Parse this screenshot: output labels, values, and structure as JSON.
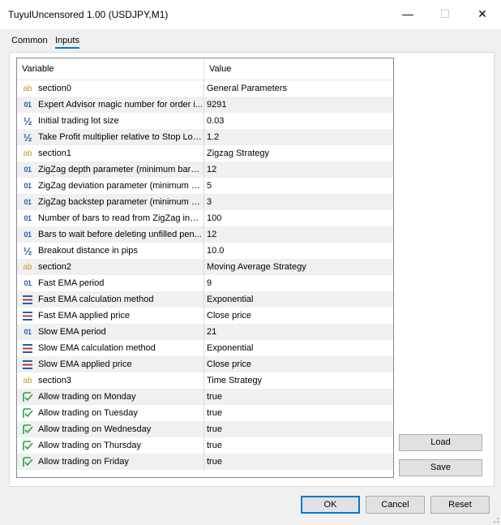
{
  "window": {
    "title": "TuyulUncensored 1.00 (USDJPY,M1)",
    "minimize_glyph": "—",
    "maximize_glyph": "☐",
    "close_glyph": "✕"
  },
  "tabs": [
    {
      "label": "Common"
    },
    {
      "label": "Inputs"
    }
  ],
  "grid": {
    "columns": {
      "variable": "Variable",
      "value": "Value"
    },
    "rows": [
      {
        "icon": "ab",
        "icon_glyph": "ab",
        "variable": "section0",
        "value": "General Parameters"
      },
      {
        "icon": "01",
        "icon_glyph": "01",
        "variable": "Expert Advisor magic number for order i...",
        "value": "9291"
      },
      {
        "icon": "half",
        "icon_glyph": "½",
        "variable": "Initial trading lot size",
        "value": "0.03"
      },
      {
        "icon": "half",
        "icon_glyph": "½",
        "variable": "Take Profit multiplier relative to Stop Los...",
        "value": "1.2"
      },
      {
        "icon": "ab",
        "icon_glyph": "ab",
        "variable": "section1",
        "value": "Zigzag Strategy"
      },
      {
        "icon": "01",
        "icon_glyph": "01",
        "variable": "ZigZag depth parameter (minimum bars ...",
        "value": "12"
      },
      {
        "icon": "01",
        "icon_glyph": "01",
        "variable": "ZigZag deviation parameter (minimum pr...",
        "value": "5"
      },
      {
        "icon": "01",
        "icon_glyph": "01",
        "variable": "ZigZag backstep parameter (minimum ba...",
        "value": "3"
      },
      {
        "icon": "01",
        "icon_glyph": "01",
        "variable": "Number of bars to read from ZigZag indi...",
        "value": "100"
      },
      {
        "icon": "01",
        "icon_glyph": "01",
        "variable": "Bars to wait before deleting unfilled pen...",
        "value": "12"
      },
      {
        "icon": "half",
        "icon_glyph": "½",
        "variable": "Breakout distance in pips",
        "value": "10.0"
      },
      {
        "icon": "ab",
        "icon_glyph": "ab",
        "variable": "section2",
        "value": "Moving Average Strategy"
      },
      {
        "icon": "01",
        "icon_glyph": "01",
        "variable": "Fast EMA period",
        "value": "9"
      },
      {
        "icon": "enum",
        "icon_glyph": "",
        "variable": "Fast EMA calculation method",
        "value": "Exponential"
      },
      {
        "icon": "enum",
        "icon_glyph": "",
        "variable": "Fast EMA applied price",
        "value": "Close price"
      },
      {
        "icon": "01",
        "icon_glyph": "01",
        "variable": "Slow EMA period",
        "value": "21"
      },
      {
        "icon": "enum",
        "icon_glyph": "",
        "variable": "Slow EMA calculation method",
        "value": "Exponential"
      },
      {
        "icon": "enum",
        "icon_glyph": "",
        "variable": "Slow EMA applied price",
        "value": "Close price"
      },
      {
        "icon": "ab",
        "icon_glyph": "ab",
        "variable": "section3",
        "value": "Time Strategy"
      },
      {
        "icon": "bool",
        "icon_glyph": "",
        "variable": "Allow trading on Monday",
        "value": "true"
      },
      {
        "icon": "bool",
        "icon_glyph": "",
        "variable": "Allow trading on Tuesday",
        "value": "true"
      },
      {
        "icon": "bool",
        "icon_glyph": "",
        "variable": "Allow trading on Wednesday",
        "value": "true"
      },
      {
        "icon": "bool",
        "icon_glyph": "",
        "variable": "Allow trading on Thursday",
        "value": "true"
      },
      {
        "icon": "bool",
        "icon_glyph": "",
        "variable": "Allow trading on Friday",
        "value": "true"
      }
    ]
  },
  "side_buttons": {
    "load": "Load",
    "save": "Save"
  },
  "footer_buttons": {
    "ok": "OK",
    "cancel": "Cancel",
    "reset": "Reset"
  },
  "colors": {
    "accent": "#0078d7",
    "alt_row": "#f0f0f0",
    "icon_blue": "#1f5fbf",
    "icon_gold": "#c19a30",
    "icon_green": "#2e9e3e"
  }
}
